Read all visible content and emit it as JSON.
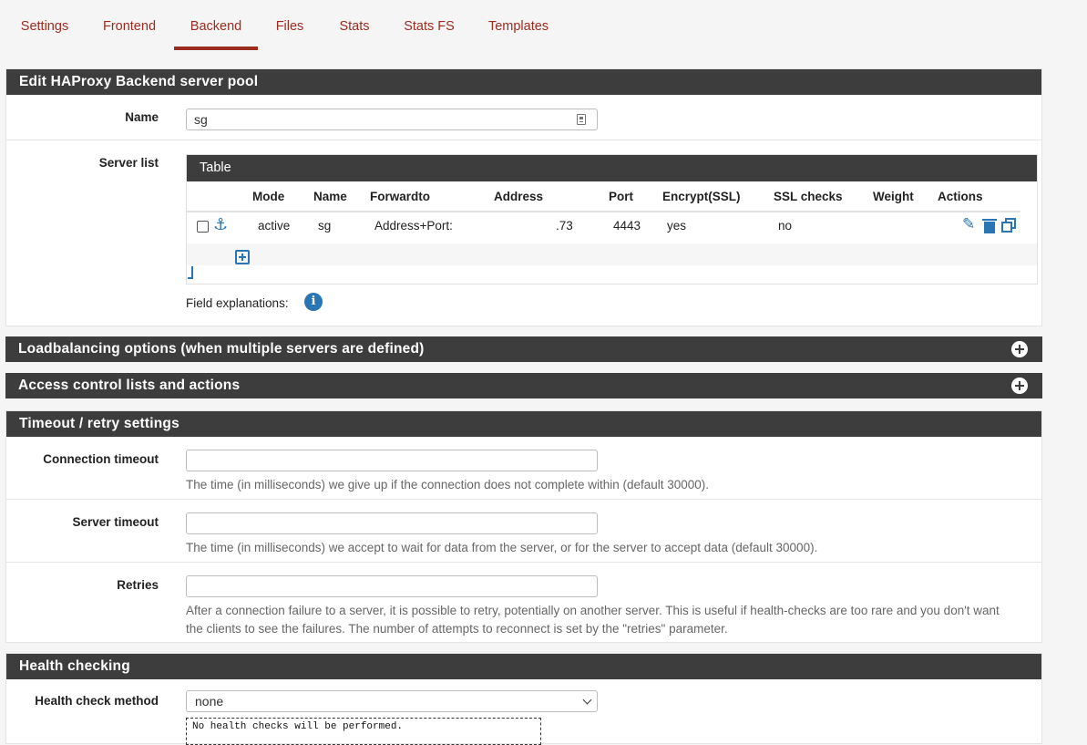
{
  "tabs": [
    {
      "label": "Settings"
    },
    {
      "label": "Frontend"
    },
    {
      "label": "Backend"
    },
    {
      "label": "Files"
    },
    {
      "label": "Stats"
    },
    {
      "label": "Stats FS"
    },
    {
      "label": "Templates"
    }
  ],
  "active_tab": "Backend",
  "edit_panel": {
    "title": "Edit HAProxy Backend server pool",
    "name_label": "Name",
    "name_value": "sg",
    "server_list_label": "Server list",
    "table_title": "Table",
    "columns": [
      "Mode",
      "Name",
      "Forwardto",
      "Address",
      "Port",
      "Encrypt(SSL)",
      "SSL checks",
      "Weight",
      "Actions"
    ],
    "rows": [
      {
        "mode": "active",
        "name": "sg",
        "forwardto": "Address+Port:",
        "address": ".73",
        "port": "4443",
        "encrypt": "yes",
        "ssl_checks": "no",
        "weight": ""
      }
    ],
    "field_explanations": "Field explanations:"
  },
  "loadbalancing_panel": {
    "title": "Loadbalancing options (when multiple servers are defined)"
  },
  "acl_panel": {
    "title": "Access control lists and actions"
  },
  "timeout_panel": {
    "title": "Timeout / retry settings",
    "connection_timeout": {
      "label": "Connection timeout",
      "value": "",
      "help": "The time (in milliseconds) we give up if the connection does not complete within (default 30000)."
    },
    "server_timeout": {
      "label": "Server timeout",
      "value": "",
      "help": "The time (in milliseconds) we accept to wait for data from the server, or for the server to accept data (default 30000)."
    },
    "retries": {
      "label": "Retries",
      "value": "",
      "help_line1": "After a connection failure to a server, it is possible to retry, potentially on another server. This is useful if health-checks are too rare and you don't want",
      "help_line2": "the clients to see the failures. The number of attempts to reconnect is set by the \"retries\" parameter."
    }
  },
  "health_panel": {
    "title": "Health checking",
    "method_label": "Health check method",
    "method_value": "none",
    "note": "No health checks will be performed."
  },
  "colors": {
    "accent": "#9b2c20",
    "header_bg": "#3d3d3d",
    "icon_blue": "#2a75b3"
  }
}
